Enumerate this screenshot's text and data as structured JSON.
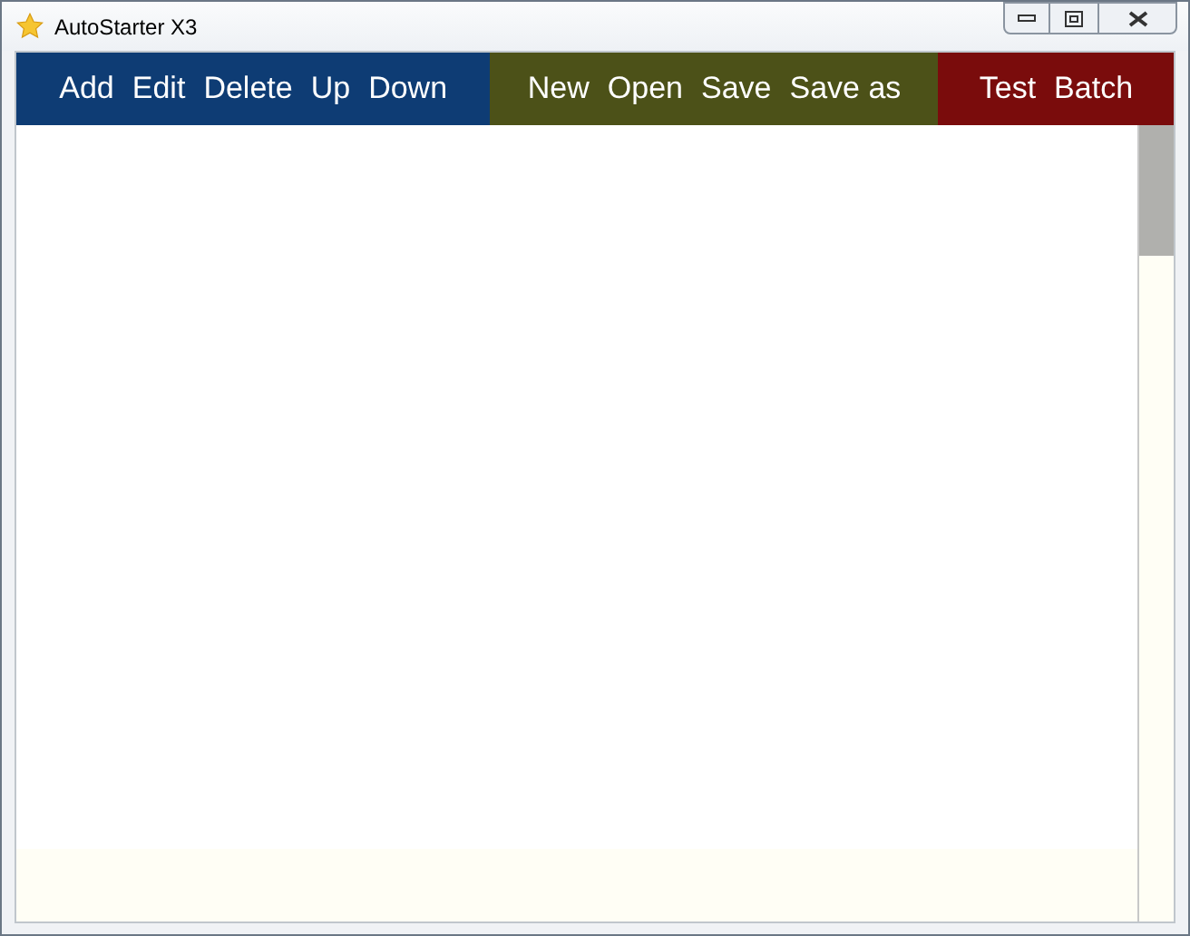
{
  "window": {
    "title": "AutoStarter X3"
  },
  "toolbar": {
    "groups": [
      {
        "color": "#0e3c74",
        "buttons": [
          "Add",
          "Edit",
          "Delete",
          "Up",
          "Down"
        ]
      },
      {
        "color": "#4c5118",
        "buttons": [
          "New",
          "Open",
          "Save",
          "Save as"
        ]
      },
      {
        "color": "#7a0c0c",
        "buttons": [
          "Test",
          "Batch"
        ]
      }
    ]
  }
}
